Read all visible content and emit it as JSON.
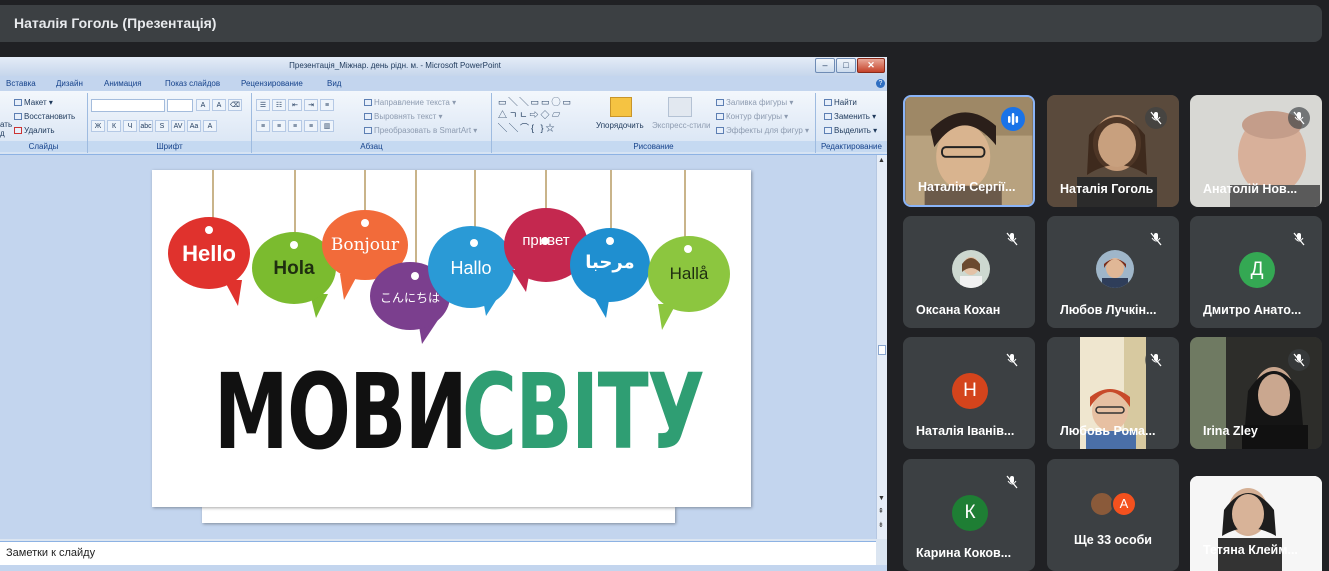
{
  "presenter": {
    "banner": "Наталія Гоголь (Презентація)"
  },
  "powerpoint": {
    "window_title": "Презентація_Міжнар. день рідн. м. - Microsoft PowerPoint",
    "window_buttons": {
      "minimize": "–",
      "maximize": "□",
      "close": "✕"
    },
    "tabs": [
      "Вставка",
      "Дизайн",
      "Анимация",
      "Показ слайдов",
      "Рецензирование",
      "Вид"
    ],
    "help": "?",
    "ribbon": {
      "slides": {
        "label": "Слайды",
        "items": [
          "Макет",
          "Восстановить",
          "Удалить"
        ],
        "cut_letters": [
          "ать",
          "д"
        ]
      },
      "font": {
        "label": "Шрифт",
        "buttons": [
          "Ж",
          "К",
          "Ч",
          "abc",
          "S",
          "AV",
          "Aa",
          "A"
        ]
      },
      "paragraph": {
        "label": "Абзац",
        "items": [
          "Направление текста",
          "Выровнять текст",
          "Преобразовать в SmartArt"
        ]
      },
      "drawing": {
        "label": "Рисование",
        "shapes": "▭╲╲▭▭◯▭ △ㄱㄴ⇨◇▱ ╲╲⌒{ }☆",
        "arrange": "Упорядочить",
        "quick_styles": "Экспресс-стили",
        "items": [
          "Заливка фигуры",
          "Контур фигуры",
          "Эффекты для фигур"
        ]
      },
      "editing": {
        "label": "Редактирование",
        "items": [
          "Найти",
          "Заменить",
          "Выделить"
        ]
      }
    },
    "notes_placeholder": "Заметки к слайду"
  },
  "slide": {
    "bubbles": [
      {
        "text": "Hello",
        "color": "#e0322d"
      },
      {
        "text": "Hola",
        "color": "#7bbb2f"
      },
      {
        "text": "Bonjour",
        "color": "#f26b3a"
      },
      {
        "text": "こんにちは",
        "color": "#7b3f8e"
      },
      {
        "text": "Hallo",
        "color": "#2a9ad6"
      },
      {
        "text": "привет",
        "color": "#c4284f"
      },
      {
        "text": "مرحبا",
        "color": "#1f8fd0"
      },
      {
        "text": "Hallå",
        "color": "#8cc63f"
      }
    ],
    "title_black": "МОВИ",
    "title_green": "СВІТУ"
  },
  "participants": [
    {
      "name": "Наталія Сергії...",
      "speaking": true,
      "kind": "video"
    },
    {
      "name": "Наталія Гоголь",
      "kind": "video"
    },
    {
      "name": "Анатолій Нов...",
      "kind": "video"
    },
    {
      "name": "Оксана Кохан",
      "kind": "photo"
    },
    {
      "name": "Любов Лучкін...",
      "kind": "photo"
    },
    {
      "name": "Дмитро Анато...",
      "kind": "letter",
      "letter": "Д",
      "color": "#34a853"
    },
    {
      "name": "Наталія Іванів...",
      "kind": "letter",
      "letter": "Н",
      "color": "#d4441c"
    },
    {
      "name": "Любовь Рома...",
      "kind": "video"
    },
    {
      "name": "Irina Zley",
      "kind": "video"
    },
    {
      "name": "Карина Коков...",
      "kind": "letter",
      "letter": "К",
      "color": "#1e7e34"
    },
    {
      "name": "Ще 33 особи",
      "kind": "more",
      "letter": "А",
      "color": "#f4511e"
    },
    {
      "name": "Тетяна Клейм...",
      "kind": "video"
    }
  ]
}
